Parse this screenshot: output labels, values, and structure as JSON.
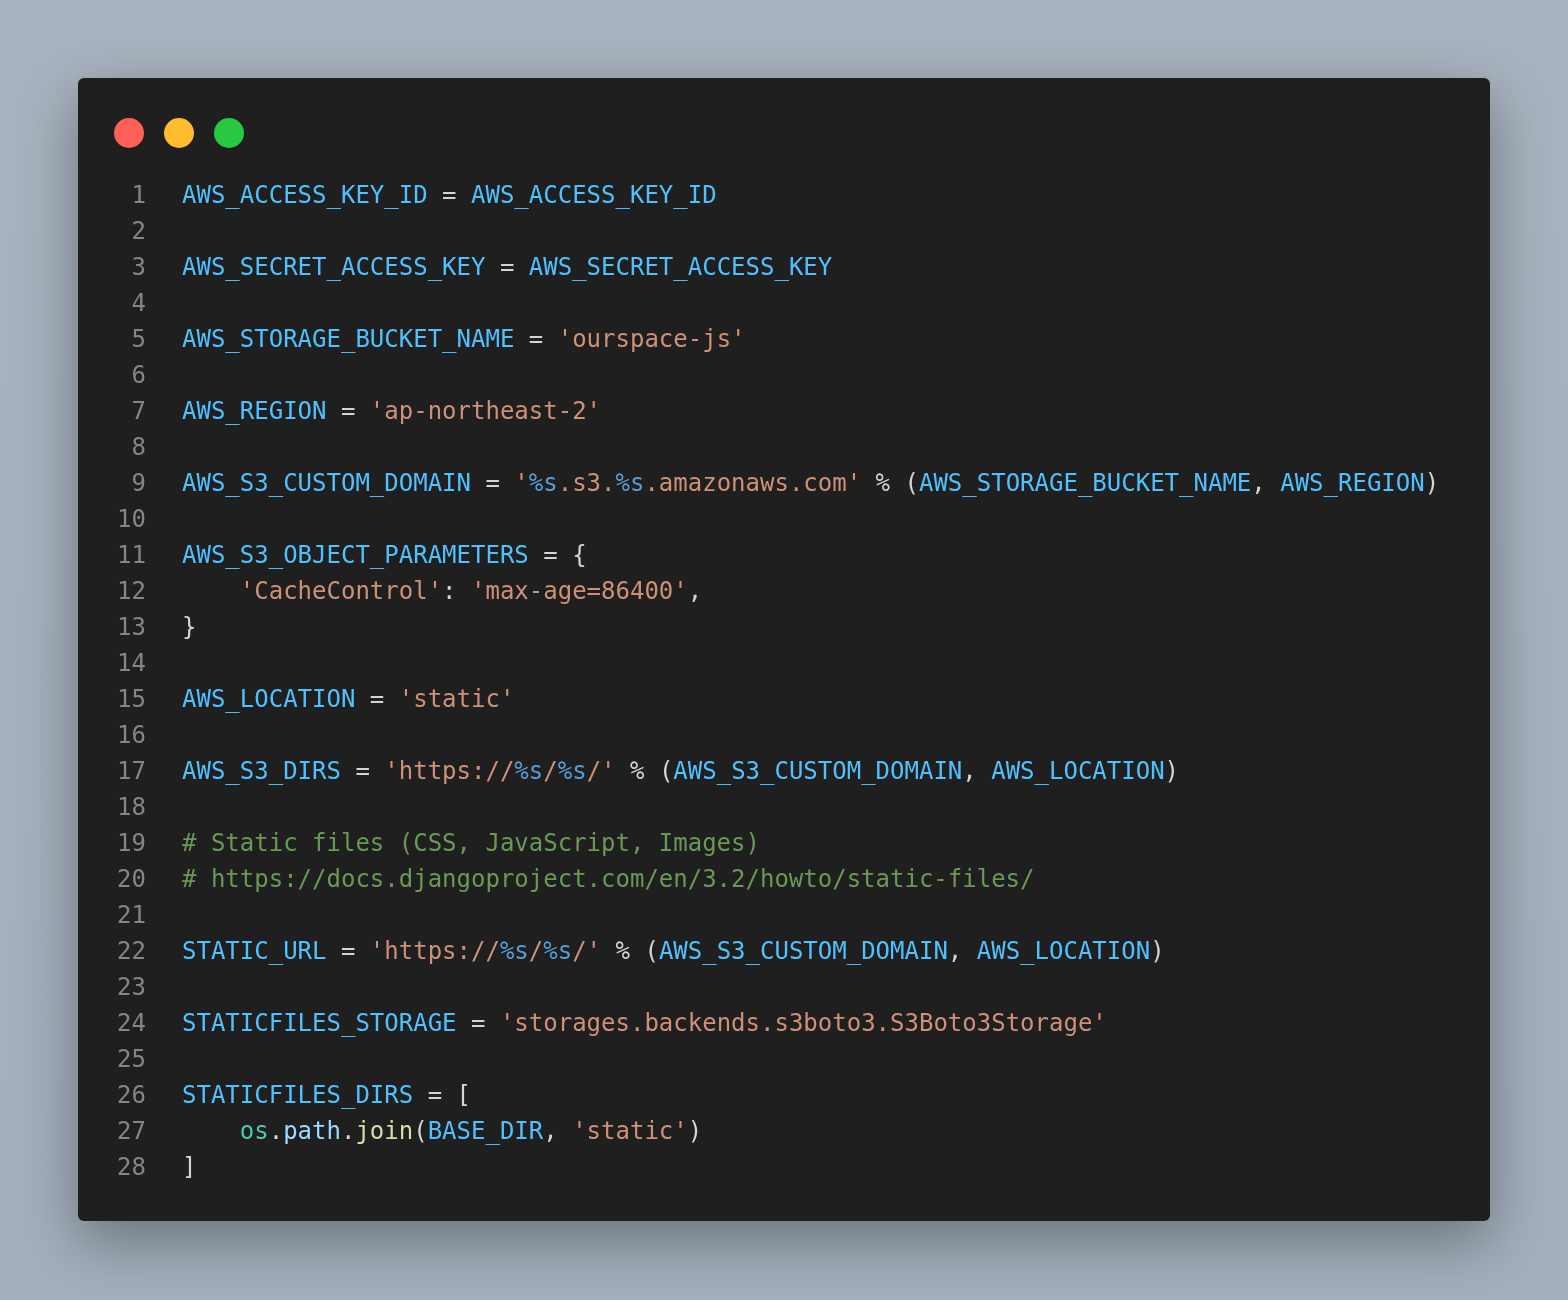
{
  "window_controls": [
    {
      "color": "#ff5f57"
    },
    {
      "color": "#febc2e"
    },
    {
      "color": "#28c840"
    }
  ],
  "lines": [
    {
      "number": "1",
      "tokens": [
        {
          "kind": "var",
          "text": "AWS_ACCESS_KEY_ID"
        },
        {
          "kind": "op",
          "text": " = "
        },
        {
          "kind": "var",
          "text": "AWS_ACCESS_KEY_ID"
        }
      ]
    },
    {
      "number": "2"
    },
    {
      "number": "3",
      "tokens": [
        {
          "kind": "var",
          "text": "AWS_SECRET_ACCESS_KEY"
        },
        {
          "kind": "op",
          "text": " = "
        },
        {
          "kind": "var",
          "text": "AWS_SECRET_ACCESS_KEY"
        }
      ]
    },
    {
      "number": "4"
    },
    {
      "number": "5",
      "tokens": [
        {
          "kind": "var",
          "text": "AWS_STORAGE_BUCKET_NAME"
        },
        {
          "kind": "op",
          "text": " = "
        },
        {
          "kind": "str",
          "text": "'ourspace-js'"
        }
      ]
    },
    {
      "number": "6"
    },
    {
      "number": "7",
      "tokens": [
        {
          "kind": "var",
          "text": "AWS_REGION"
        },
        {
          "kind": "op",
          "text": " = "
        },
        {
          "kind": "str",
          "text": "'ap-northeast-2'"
        }
      ]
    },
    {
      "number": "8"
    },
    {
      "number": "9",
      "tokens": [
        {
          "kind": "var",
          "text": "AWS_S3_CUSTOM_DOMAIN"
        },
        {
          "kind": "op",
          "text": " = "
        },
        {
          "kind": "str",
          "text": "'"
        },
        {
          "kind": "fmt",
          "text": "%s"
        },
        {
          "kind": "str",
          "text": ".s3."
        },
        {
          "kind": "fmt",
          "text": "%s"
        },
        {
          "kind": "str",
          "text": ".amazonaws.com'"
        },
        {
          "kind": "op",
          "text": " % ("
        },
        {
          "kind": "var",
          "text": "AWS_STORAGE_BUCKET_NAME"
        },
        {
          "kind": "op",
          "text": ", "
        },
        {
          "kind": "var",
          "text": "AWS_REGION"
        },
        {
          "kind": "op",
          "text": ")"
        }
      ]
    },
    {
      "number": "10"
    },
    {
      "number": "11",
      "tokens": [
        {
          "kind": "var",
          "text": "AWS_S3_OBJECT_PARAMETERS"
        },
        {
          "kind": "op",
          "text": " = {"
        }
      ]
    },
    {
      "number": "12",
      "indent": true,
      "tokens": [
        {
          "kind": "str",
          "text": "'CacheControl'"
        },
        {
          "kind": "op",
          "text": ": "
        },
        {
          "kind": "str",
          "text": "'max-age=86400'"
        },
        {
          "kind": "op",
          "text": ","
        }
      ]
    },
    {
      "number": "13",
      "tokens": [
        {
          "kind": "op",
          "text": "}"
        }
      ]
    },
    {
      "number": "14"
    },
    {
      "number": "15",
      "tokens": [
        {
          "kind": "var",
          "text": "AWS_LOCATION"
        },
        {
          "kind": "op",
          "text": " = "
        },
        {
          "kind": "str",
          "text": "'static'"
        }
      ]
    },
    {
      "number": "16"
    },
    {
      "number": "17",
      "tokens": [
        {
          "kind": "var",
          "text": "AWS_S3_DIRS"
        },
        {
          "kind": "op",
          "text": " = "
        },
        {
          "kind": "str",
          "text": "'https://"
        },
        {
          "kind": "fmt",
          "text": "%s"
        },
        {
          "kind": "str",
          "text": "/"
        },
        {
          "kind": "fmt",
          "text": "%s"
        },
        {
          "kind": "str",
          "text": "/'"
        },
        {
          "kind": "op",
          "text": " % ("
        },
        {
          "kind": "var",
          "text": "AWS_S3_CUSTOM_DOMAIN"
        },
        {
          "kind": "op",
          "text": ", "
        },
        {
          "kind": "var",
          "text": "AWS_LOCATION"
        },
        {
          "kind": "op",
          "text": ")"
        }
      ]
    },
    {
      "number": "18"
    },
    {
      "number": "19",
      "tokens": [
        {
          "kind": "comment",
          "text": "# Static files (CSS, JavaScript, Images)"
        }
      ]
    },
    {
      "number": "20",
      "tokens": [
        {
          "kind": "comment",
          "text": "# https://docs.djangoproject.com/en/3.2/howto/static-files/"
        }
      ]
    },
    {
      "number": "21"
    },
    {
      "number": "22",
      "tokens": [
        {
          "kind": "var",
          "text": "STATIC_URL"
        },
        {
          "kind": "op",
          "text": " = "
        },
        {
          "kind": "str",
          "text": "'https://"
        },
        {
          "kind": "fmt",
          "text": "%s"
        },
        {
          "kind": "str",
          "text": "/"
        },
        {
          "kind": "fmt",
          "text": "%s"
        },
        {
          "kind": "str",
          "text": "/'"
        },
        {
          "kind": "op",
          "text": " % ("
        },
        {
          "kind": "var",
          "text": "AWS_S3_CUSTOM_DOMAIN"
        },
        {
          "kind": "op",
          "text": ", "
        },
        {
          "kind": "var",
          "text": "AWS_LOCATION"
        },
        {
          "kind": "op",
          "text": ")"
        }
      ]
    },
    {
      "number": "23"
    },
    {
      "number": "24",
      "tokens": [
        {
          "kind": "var",
          "text": "STATICFILES_STORAGE"
        },
        {
          "kind": "op",
          "text": " = "
        },
        {
          "kind": "str",
          "text": "'storages.backends.s3boto3.S3Boto3Storage'"
        }
      ]
    },
    {
      "number": "25"
    },
    {
      "number": "26",
      "tokens": [
        {
          "kind": "var",
          "text": "STATICFILES_DIRS"
        },
        {
          "kind": "op",
          "text": " = ["
        }
      ]
    },
    {
      "number": "27",
      "indent": true,
      "tokens": [
        {
          "kind": "module",
          "text": "os"
        },
        {
          "kind": "op",
          "text": "."
        },
        {
          "kind": "prop",
          "text": "path"
        },
        {
          "kind": "op",
          "text": "."
        },
        {
          "kind": "func",
          "text": "join"
        },
        {
          "kind": "op",
          "text": "("
        },
        {
          "kind": "var",
          "text": "BASE_DIR"
        },
        {
          "kind": "op",
          "text": ", "
        },
        {
          "kind": "str",
          "text": "'static'"
        },
        {
          "kind": "op",
          "text": ")"
        }
      ]
    },
    {
      "number": "28",
      "tokens": [
        {
          "kind": "op",
          "text": "]"
        }
      ]
    }
  ]
}
